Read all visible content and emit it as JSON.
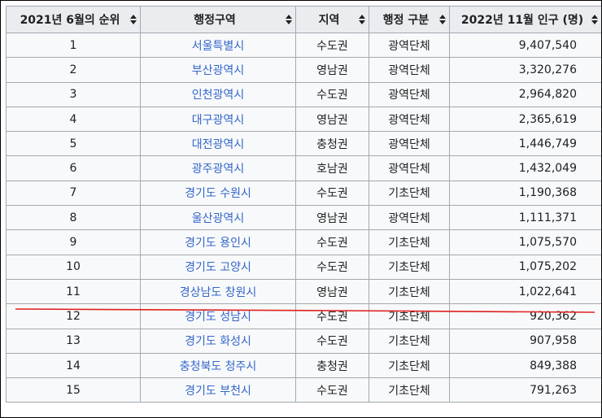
{
  "headers": [
    {
      "label": "2021년 6월의 순위",
      "sort_icon": "sort-both-icon"
    },
    {
      "label": "행정구역",
      "sort_icon": "sort-both-icon"
    },
    {
      "label": "지역",
      "sort_icon": "sort-both-icon"
    },
    {
      "label": "행정 구분",
      "sort_icon": "sort-both-icon"
    },
    {
      "label": "2022년 11월 인구 (명)",
      "sort_icon": "sort-both-icon"
    }
  ],
  "rows": [
    {
      "rank": "1",
      "region": "서울특별시",
      "area": "수도권",
      "type": "광역단체",
      "population": "9,407,540"
    },
    {
      "rank": "2",
      "region": "부산광역시",
      "area": "영남권",
      "type": "광역단체",
      "population": "3,320,276"
    },
    {
      "rank": "3",
      "region": "인천광역시",
      "area": "수도권",
      "type": "광역단체",
      "population": "2,964,820"
    },
    {
      "rank": "4",
      "region": "대구광역시",
      "area": "영남권",
      "type": "광역단체",
      "population": "2,365,619"
    },
    {
      "rank": "5",
      "region": "대전광역시",
      "area": "충청권",
      "type": "광역단체",
      "population": "1,446,749"
    },
    {
      "rank": "6",
      "region": "광주광역시",
      "area": "호남권",
      "type": "광역단체",
      "population": "1,432,049"
    },
    {
      "rank": "7",
      "region": "경기도 수원시",
      "area": "수도권",
      "type": "기초단체",
      "population": "1,190,368"
    },
    {
      "rank": "8",
      "region": "울산광역시",
      "area": "영남권",
      "type": "광역단체",
      "population": "1,111,371"
    },
    {
      "rank": "9",
      "region": "경기도 용인시",
      "area": "수도권",
      "type": "기초단체",
      "population": "1,075,570"
    },
    {
      "rank": "10",
      "region": "경기도 고양시",
      "area": "수도권",
      "type": "기초단체",
      "population": "1,075,202"
    },
    {
      "rank": "11",
      "region": "경상남도 창원시",
      "area": "영남권",
      "type": "기초단체",
      "population": "1,022,641"
    },
    {
      "rank": "12",
      "region": "경기도 성남시",
      "area": "수도권",
      "type": "기초단체",
      "population": "920,362"
    },
    {
      "rank": "13",
      "region": "경기도 화성시",
      "area": "수도권",
      "type": "기초단체",
      "population": "907,958"
    },
    {
      "rank": "14",
      "region": "충청북도 청주시",
      "area": "충청권",
      "type": "기초단체",
      "population": "849,388"
    },
    {
      "rank": "15",
      "region": "경기도 부천시",
      "area": "수도권",
      "type": "기초단체",
      "population": "791,263"
    }
  ],
  "colors": {
    "link": "#3366cc",
    "header_bg": "#eaecf0",
    "cell_bg": "#f8f9fa",
    "border": "#a2a9b1",
    "underline_annotation": "#e02020"
  }
}
